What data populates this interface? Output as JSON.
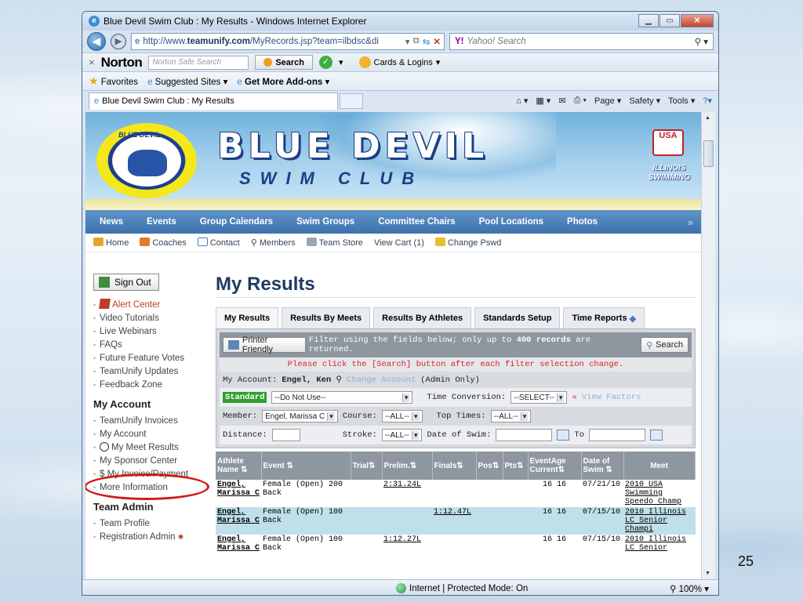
{
  "slide_number": "25",
  "window": {
    "title": "Blue Devil Swim Club : My Results - Windows Internet Explorer",
    "url_prefix": "http://www.",
    "url_domain": "teamunify.com",
    "url_path": "/MyRecords.jsp?team=ilbdsc&di",
    "yahoo_search_placeholder": "Yahoo! Search",
    "norton_search_placeholder": "Norton Safe Search",
    "norton_search_button": "Search",
    "norton_label": "Norton",
    "cards_logins": "Cards & Logins",
    "favorites": "Favorites",
    "suggested_sites": "Suggested Sites",
    "get_more_addons": "Get More Add-ons",
    "tab_title": "Blue Devil Swim Club : My Results",
    "cmd_page": "Page",
    "cmd_safety": "Safety",
    "cmd_tools": "Tools",
    "status_zone": "Internet | Protected Mode: On",
    "zoom": "100%"
  },
  "banner": {
    "title": "BLUE DEVIL",
    "subtitle": "SWIM CLUB",
    "logo_text": "BLUE DEVIL",
    "usa_label": "USA",
    "illinois": "ILLINOIS",
    "swimming": "SWIMMING"
  },
  "main_nav": [
    "News",
    "Events",
    "Group Calendars",
    "Swim Groups",
    "Committee Chairs",
    "Pool Locations",
    "Photos"
  ],
  "sub_nav": {
    "home": "Home",
    "coaches": "Coaches",
    "contact": "Contact",
    "members": "Members",
    "team_store": "Team Store",
    "view_cart": "View Cart (1)",
    "change_pswd": "Change Pswd"
  },
  "sidebar": {
    "sign_out": "Sign Out",
    "links1": [
      "Alert Center",
      "Video Tutorials",
      "Live Webinars",
      "FAQs",
      "Future Feature Votes",
      "TeamUnify Updates",
      "Feedback Zone"
    ],
    "my_account_heading": "My Account",
    "links2": [
      "TeamUnify Invoices",
      "My Account",
      "My Meet Results",
      "My Sponsor Center",
      "$ My Invoice/Payment",
      "More Information"
    ],
    "team_admin_heading": "Team Admin",
    "links3": [
      "Team Profile",
      "Registration Admin"
    ]
  },
  "page_title": "My Results",
  "result_tabs": [
    "My Results",
    "Results By Meets",
    "Results By Athletes",
    "Standards Setup",
    "Time Reports"
  ],
  "filters": {
    "printer_friendly": "Printer Friendly",
    "filter_note_pre": "Filter using the fields below; only up to ",
    "filter_note_bold": "400 records",
    "filter_note_post": " are returned.",
    "search_button": "Search",
    "please_click": "Please click the [Search] button after each filter selection change.",
    "my_account_label": "My Account: ",
    "my_account_name": "Engel, Ken",
    "change_account": "Change Account",
    "admin_only": "(Admin Only)",
    "standard_label": "Standard",
    "standard_value": "--Do Not Use--",
    "time_conversion_label": "Time Conversion:",
    "time_conversion_value": "--SELECT--",
    "view_factors": "View Factors",
    "member_label": "Member:",
    "member_value": "Engel, Marissa C",
    "course_label": "Course:",
    "course_value": "--ALL--",
    "top_times_label": "Top Times:",
    "top_times_value": "--ALL--",
    "distance_label": "Distance:",
    "stroke_label": "Stroke:",
    "stroke_value": "--ALL--",
    "date_of_swim_label": "Date of Swim:",
    "to_label": "To"
  },
  "table": {
    "headers": [
      "Athlete Name",
      "Event",
      "Trial",
      "Prelim.",
      "Finals",
      "Pos",
      "Pts",
      "EventAge Current",
      "Date of Swim",
      "Meet"
    ],
    "rows": [
      {
        "athlete": "Engel, Marissa C",
        "event": "Female (Open) 200 Back",
        "trial": "",
        "prelim": "2:31.24L",
        "finals": "",
        "pos": "",
        "pts": "",
        "age": "16 16",
        "date": "07/21/10",
        "meet": "2010 USA Swimming Speedo Champ"
      },
      {
        "athlete": "Engel, Marissa C",
        "event": "Female (Open) 100 Back",
        "trial": "",
        "prelim": "",
        "finals": "1:12.47L",
        "pos": "",
        "pts": "",
        "age": "16 16",
        "date": "07/15/10",
        "meet": "2010 Illinois LC Senior Champi"
      },
      {
        "athlete": "Engel, Marissa C",
        "event": "Female (Open) 100 Back",
        "trial": "",
        "prelim": "1:12.27L",
        "finals": "",
        "pos": "",
        "pts": "",
        "age": "16 16",
        "date": "07/15/10",
        "meet": "2010 Illinois LC Senior"
      }
    ]
  }
}
